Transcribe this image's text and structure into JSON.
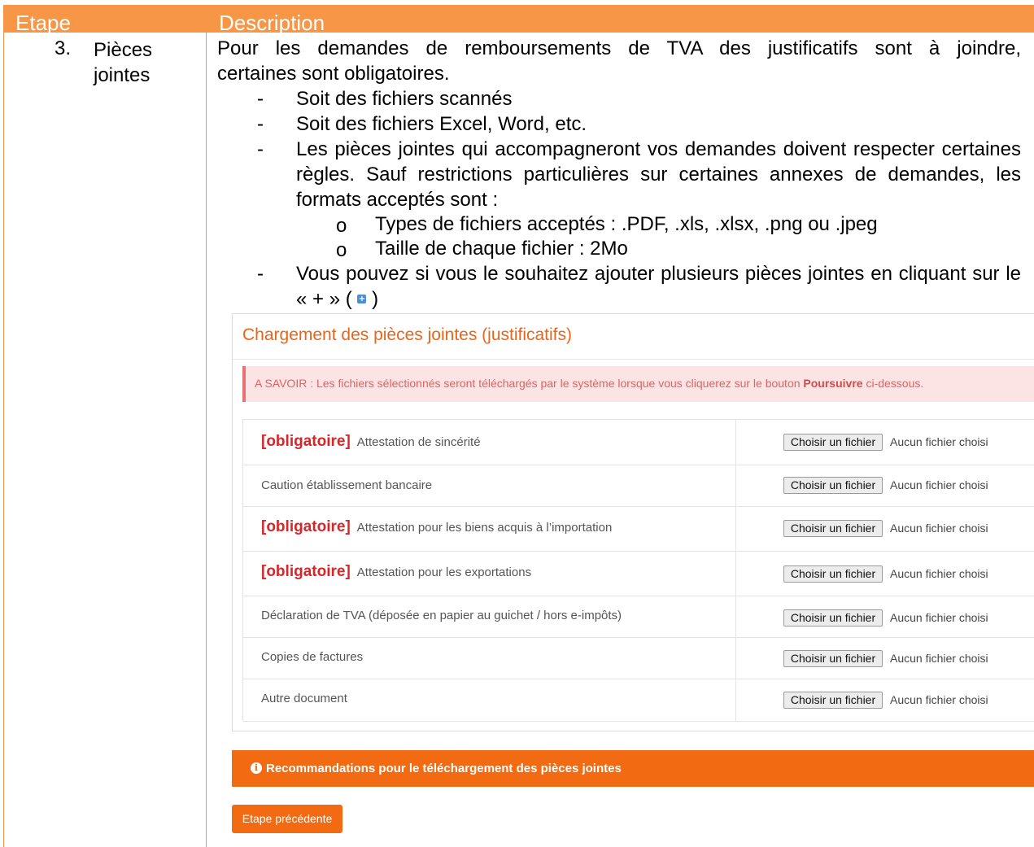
{
  "table": {
    "col1_header": "Etape",
    "col2_header": "Description",
    "step_number": "3.",
    "step_label_line1": "Pièces",
    "step_label_line2": "jointes"
  },
  "description": {
    "intro_line1": "Pour les demandes de remboursements de TVA des justificatifs sont à joindre,",
    "intro_line2": "certaines sont obligatoires.",
    "bullet_marker": "-",
    "bullets": [
      "Soit des fichiers scannés",
      "Soit des fichiers Excel, Word, etc.",
      "Les pièces jointes qui accompagneront vos demandes doivent respecter certaines règles. Sauf restrictions particulières sur certaines annexes de demandes, les formats acceptés sont :",
      "Vous pouvez si vous le souhaitez ajouter plusieurs pièces jointes en cliquant sur le « + » ("
    ],
    "bullet4_suffix": ")",
    "sub_marker": "o",
    "sub_bullets": [
      "Types de fichiers acceptés : .PDF, .xls, .xlsx, .png ou .jpeg",
      "Taille de chaque fichier : 2Mo"
    ],
    "plus_icon_glyph": "+"
  },
  "screenshot": {
    "title": "Chargement des pièces jointes (justificatifs)",
    "alert_prefix": "A SAVOIR : Les fichiers sélectionnés seront téléchargés par le système lorsque vous cliquerez sur le bouton ",
    "alert_bold": "Poursuivre",
    "alert_suffix": " ci-dessous.",
    "required_tag": "[obligatoire]",
    "choose_button": "Choisir un fichier",
    "no_file": "Aucun fichier choisi",
    "rows": [
      {
        "label": "Attestation de sincérité",
        "required": true
      },
      {
        "label": "Caution établissement bancaire",
        "required": false
      },
      {
        "label": "Attestation pour les biens acquis à l’importation",
        "required": true
      },
      {
        "label": "Attestation pour les exportations",
        "required": true
      },
      {
        "label": "Déclaration de TVA (déposée en papier au guichet / hors e-impôts)",
        "required": false
      },
      {
        "label": "Copies de factures",
        "required": false
      },
      {
        "label": "Autre document",
        "required": false
      }
    ],
    "recommendations": "Recommandations pour le téléchargement des pièces jointes",
    "info_icon_glyph": "i",
    "prev_button": "Etape précédente"
  },
  "colors": {
    "header_orange": "#f79646",
    "brand_orange": "#f26b12",
    "required_red": "#d7262a",
    "alert_bg": "#fce4e4"
  }
}
